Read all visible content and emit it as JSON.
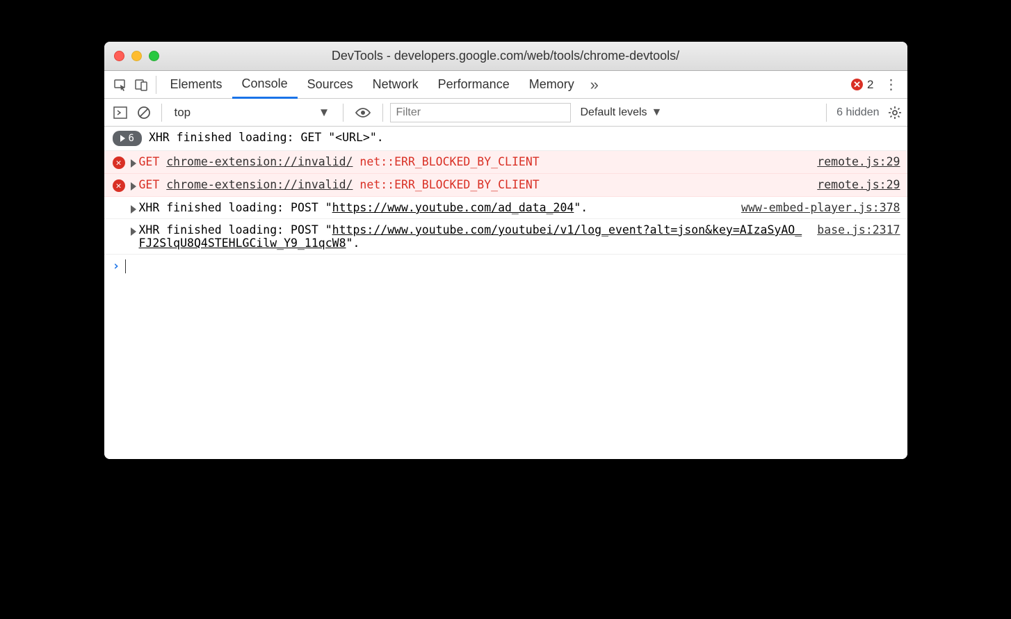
{
  "titlebar": {
    "title": "DevTools - developers.google.com/web/tools/chrome-devtools/"
  },
  "tabs": {
    "elements": "Elements",
    "console": "Console",
    "sources": "Sources",
    "network": "Network",
    "performance": "Performance",
    "memory": "Memory",
    "error_count": "2"
  },
  "toolbar": {
    "context": "top",
    "filter_placeholder": "Filter",
    "levels": "Default levels",
    "hidden": "6 hidden"
  },
  "messages": {
    "m0_count": "6",
    "m0_text": "XHR finished loading: GET \"<URL>\".",
    "m1_method": "GET",
    "m1_url": "chrome-extension://invalid/",
    "m1_err": "net::ERR_BLOCKED_BY_CLIENT",
    "m1_src": "remote.js:29",
    "m2_method": "GET",
    "m2_url": "chrome-extension://invalid/",
    "m2_err": "net::ERR_BLOCKED_BY_CLIENT",
    "m2_src": "remote.js:29",
    "m3_prefix": "XHR finished loading: POST \"",
    "m3_url": "https://www.youtube.com/ad_data_204",
    "m3_suffix": "\".",
    "m3_src": "www-embed-player.js:378",
    "m4_prefix": "XHR finished loading: POST \"",
    "m4_url": "https://www.youtube.com/youtubei/v1/log_event?alt=json&key=AIzaSyAO_FJ2SlqU8Q4STEHLGCilw_Y9_11qcW8",
    "m4_suffix": "\".",
    "m4_src": "base.js:2317"
  }
}
